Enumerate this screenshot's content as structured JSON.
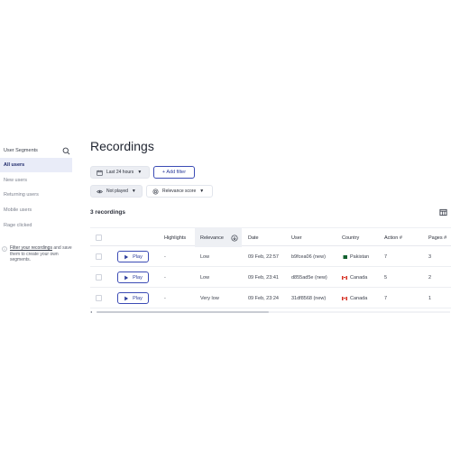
{
  "sidebar": {
    "title": "User Segments",
    "items": [
      {
        "label": "All users",
        "active": true
      },
      {
        "label": "New users",
        "active": false
      },
      {
        "label": "Returning users",
        "active": false
      },
      {
        "label": "Mobile users",
        "active": false
      },
      {
        "label": "Rage clicked",
        "active": false
      }
    ],
    "hint_link": "Filter your recordings",
    "hint_text": "and save them to create your own segments."
  },
  "header": {
    "title": "Recordings"
  },
  "filters": {
    "date_range": "Last 24 hours",
    "add_filter": "+ Add filter",
    "played": "Not played",
    "sort": "Relevance score"
  },
  "summary": {
    "count_label": "3 recordings"
  },
  "table": {
    "columns": {
      "highlights": "Highlights",
      "relevance": "Relevance",
      "date": "Date",
      "user": "User",
      "country": "Country",
      "actions": "Action #",
      "pages": "Pages #"
    },
    "play_label": "Play",
    "rows": [
      {
        "highlights": "-",
        "relevance": "Low",
        "date": "09 Feb, 22:57",
        "user": "b9fcea06 (new)",
        "country": "Pakistan",
        "flag": "pk",
        "actions": "7",
        "pages": "3"
      },
      {
        "highlights": "-",
        "relevance": "Low",
        "date": "09 Feb, 23:41",
        "user": "d855ad5e (new)",
        "country": "Canada",
        "flag": "ca",
        "actions": "5",
        "pages": "2"
      },
      {
        "highlights": "-",
        "relevance": "Very low",
        "date": "09 Feb, 23:24",
        "user": "31df8568 (new)",
        "country": "Canada",
        "flag": "ca",
        "actions": "7",
        "pages": "1"
      }
    ]
  },
  "colors": {
    "accent": "#3b4bb5",
    "active_bg": "#e9ecf8"
  },
  "icons": [
    "search-icon",
    "calendar-icon",
    "chevron-down-icon",
    "eye-icon",
    "target-icon",
    "info-icon",
    "columns-icon",
    "sort-icon",
    "play-icon"
  ]
}
